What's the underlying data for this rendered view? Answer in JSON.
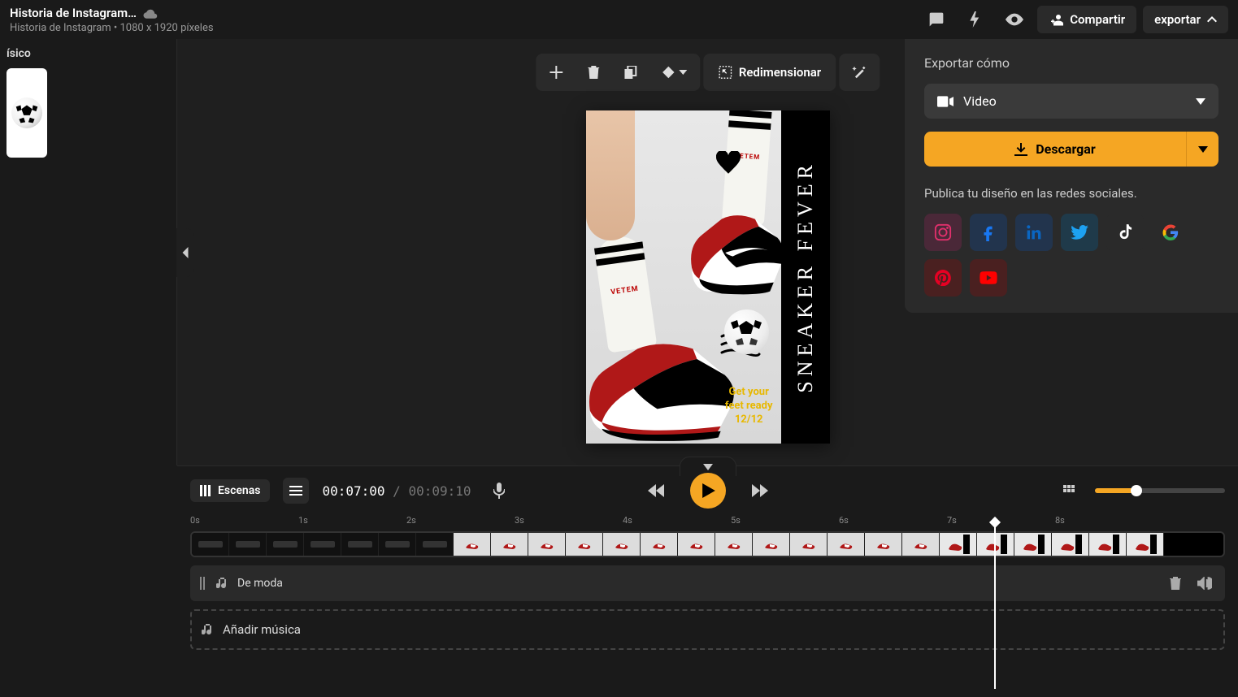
{
  "header": {
    "doc_title": "Historia de Instagram…",
    "doc_subtitle": "Historia de Instagram • 1080 x 1920 píxeles",
    "share_label": "Compartir",
    "export_label": "exportar"
  },
  "sidebar": {
    "title": "ísico"
  },
  "toolbar": {
    "resize_label": "Redimensionar"
  },
  "canvas": {
    "vertical_text": "SNEAKER FEVER",
    "yellow_line1": "Get your",
    "yellow_line2": "feet ready",
    "yellow_line3": "12/12",
    "sock_brand": "VETEM"
  },
  "export_panel": {
    "title": "Exportar cómo",
    "format_label": "Video",
    "download_label": "Descargar",
    "social_title": "Publica tu diseño en las redes sociales.",
    "socials": [
      {
        "name": "instagram",
        "bg": "#4a2838",
        "fg": "#e1306c"
      },
      {
        "name": "facebook",
        "bg": "#22344d",
        "fg": "#1877f2"
      },
      {
        "name": "linkedin",
        "bg": "#22344d",
        "fg": "#0a66c2"
      },
      {
        "name": "twitter",
        "bg": "#1f3a4a",
        "fg": "#1da1f2"
      },
      {
        "name": "tiktok",
        "bg": "#2a2a2a",
        "fg": "#fff"
      },
      {
        "name": "google",
        "bg": "#2a2a2a",
        "fg": "#ea4335"
      },
      {
        "name": "pinterest",
        "bg": "#4a2020",
        "fg": "#e60023"
      },
      {
        "name": "youtube",
        "bg": "#4a2020",
        "fg": "#ff0000"
      }
    ]
  },
  "timeline": {
    "scenes_label": "Escenas",
    "current_time": "00:07:00",
    "total_time": "00:09:10",
    "ruler_ticks": [
      "0s",
      "1s",
      "2s",
      "3s",
      "4s",
      "5s",
      "6s",
      "7s",
      "8s"
    ],
    "audio_track_label": "De moda",
    "add_music_label": "Añadir música"
  }
}
